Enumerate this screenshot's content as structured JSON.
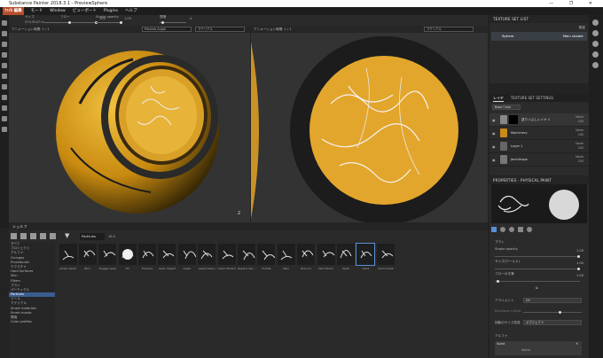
{
  "window": {
    "title": "Substance Painter 2018.3.1 - PreviewSphere",
    "controls": "— ❐ ✕"
  },
  "menu": {
    "logo": "ﾌｧｲﾙ 編集",
    "items": [
      "モード",
      "Window",
      "ビューポート",
      "Plugins",
      "ヘルプ"
    ]
  },
  "toolbar": {
    "labels": [
      "サイズ",
      "フロー",
      "Stroke opacity",
      "間隔"
    ],
    "values": [
      "570.5047 m",
      "100",
      "1.00",
      "4"
    ]
  },
  "viewport_left": {
    "label": "アニメーション時間: 1 / 1",
    "dropdown1": "Preview Angle",
    "dropdown2": "マテリアル"
  },
  "viewport_right": {
    "label": "アニメーション時間: 1 / 1",
    "dropdown2": "マテリアル"
  },
  "axis_label": "z",
  "texture_set_list": {
    "title": "TEXTURE SET LIST",
    "settings_label": "設定",
    "row": "Sphere",
    "row_shader": "Main shader"
  },
  "layers": {
    "tabs": [
      "レイヤ",
      "TEXTURE SET SETTINGS"
    ],
    "channel": "Base Color",
    "rows": [
      {
        "name": "塗りつぶしレイヤ 1",
        "blend": "Norm",
        "opacity": "100"
      },
      {
        "name": "Machinery",
        "blend": "Norm",
        "opacity": "100"
      },
      {
        "name": "Layer 1",
        "blend": "Norm",
        "opacity": "100"
      },
      {
        "name": "Jacinthope",
        "blend": "Norm",
        "opacity": "100"
      }
    ]
  },
  "properties": {
    "title": "PROPERTIES - PHYSICAL PAINT",
    "brush_label": "ブラシ",
    "rows": [
      {
        "label": "Stroke opacity",
        "value": "1.00"
      },
      {
        "label": "サイズ(ワールド)",
        "value": "1.00"
      },
      {
        "label": "フローの平滑",
        "value": "1.00"
      }
    ],
    "alignment_label": "アライメント",
    "alignment_value": "UV",
    "spacing_label": "Backface culling",
    "size_space_label": "回転のサイズ変換",
    "size_space_value": "オブジェクト",
    "alpha_label": "アルファ",
    "alpha_item": "Splat",
    "alpha_value": "alpha"
  },
  "shelf": {
    "title": "シェルフ",
    "search": "Particles",
    "count": "16.0",
    "categories": [
      "すべて",
      "プロジェクト",
      "アルファ",
      "Grunges",
      "Procedurals",
      "テクスチャ",
      "Hard Surfaces",
      "Skin",
      "Filters",
      "ブラシ",
      "パーティクル",
      "Particles",
      "ツール",
      "マテリアル",
      "Smart materials",
      "Smart masks",
      "環境",
      "Color profiles"
    ],
    "selected_category": "Particles",
    "brushes": [
      "Amber Spots",
      "Burn",
      "Dagger Leap",
      "Fill",
      "Fracture",
      "Laser Impact",
      "Leaks",
      "Leaks Heavy",
      "Liquid Stream",
      "Organic Spr...",
      "Puddle",
      "Rain",
      "Rococco",
      "Sand Storm",
      "Splat",
      "Veins",
      "Veins Small"
    ],
    "selected_brush": "Veins"
  },
  "colors": {
    "accent": "#5b8fd6",
    "sphere": "#e0a020",
    "rim": "#1a1a1a"
  }
}
